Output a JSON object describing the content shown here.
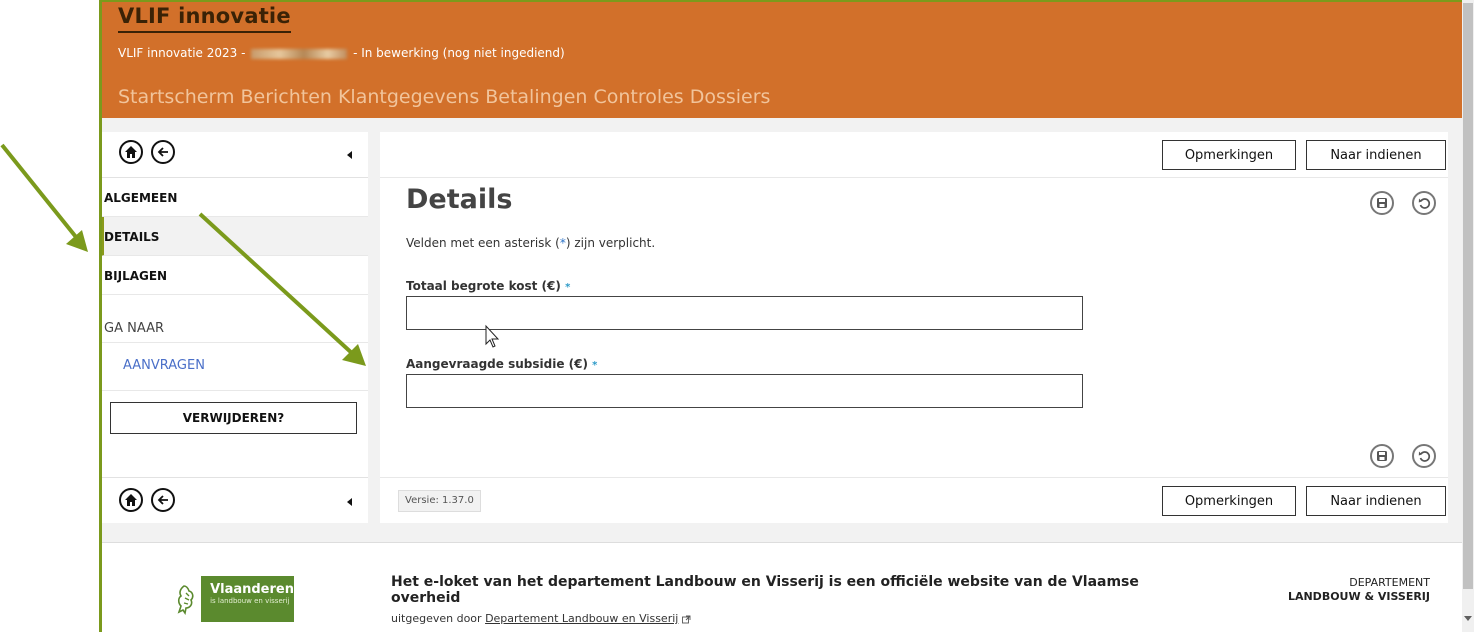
{
  "header": {
    "title": "VLIF innovatie",
    "subtitle_prefix": "VLIF innovatie 2023 -",
    "subtitle_suffix": "- In bewerking (nog niet ingediend)",
    "nav": [
      "Startscherm",
      "Berichten",
      "Klantgegevens",
      "Betalingen",
      "Controles",
      "Dossiers"
    ]
  },
  "sidebar": {
    "items": [
      "ALGEMEEN",
      "DETAILS",
      "BIJLAGEN"
    ],
    "active_item": "DETAILS",
    "goto_label": "GA NAAR",
    "goto_link": "AANVRAGEN",
    "delete_button": "VERWIJDEREN?"
  },
  "toolbar": {
    "remarks_button": "Opmerkingen",
    "submit_button": "Naar indienen"
  },
  "main": {
    "title": "Details",
    "hint_before": "Velden met een asterisk (",
    "hint_ast": "*",
    "hint_after": ") zijn verplicht.",
    "fields": [
      {
        "label": "Totaal begrote kost (€)",
        "required_mark": "*",
        "value": ""
      },
      {
        "label": "Aangevraagde subsidie (€)",
        "required_mark": "*",
        "value": ""
      }
    ],
    "version": "Versie: 1.37.0"
  },
  "footer": {
    "logo_title": "Vlaanderen",
    "logo_sub": "is landbouw en visserij",
    "text": "Het e-loket van het departement Landbouw en Visserij is een officiële website van de Vlaamse overheid",
    "published_prefix": "uitgegeven door",
    "published_link": "Departement Landbouw en Visserij",
    "dept_line1": "DEPARTEMENT",
    "dept_line2": "LANDBOUW & VISSERIJ"
  },
  "colors": {
    "header_bg": "#d2702a",
    "annotation_arrow": "#7b9a1c",
    "link": "#4a6fc8"
  },
  "icons": [
    "home-icon",
    "back-arrow-icon",
    "collapse-icon",
    "save-icon",
    "undo-icon",
    "external-link-icon",
    "annotation-arrow",
    "mouse-cursor-icon"
  ]
}
